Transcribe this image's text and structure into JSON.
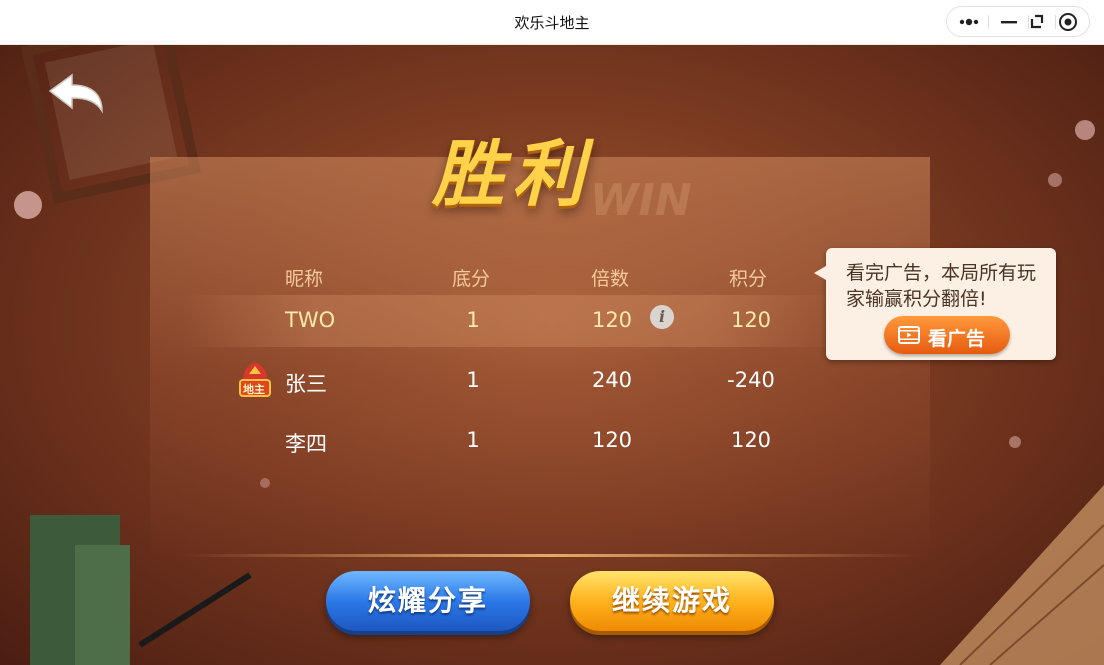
{
  "window": {
    "title": "欢乐斗地主"
  },
  "result": {
    "title": "胜利",
    "watermark": "WIN"
  },
  "table": {
    "headers": [
      "昵称",
      "底分",
      "倍数",
      "积分"
    ],
    "rows": [
      {
        "name": "TWO",
        "base": "1",
        "multiplier": "120",
        "score": "120",
        "is_landlord": false,
        "highlighted": true
      },
      {
        "name": "张三",
        "base": "1",
        "multiplier": "240",
        "score": "-240",
        "is_landlord": true,
        "highlighted": false
      },
      {
        "name": "李四",
        "base": "1",
        "multiplier": "120",
        "score": "120",
        "is_landlord": false,
        "highlighted": false
      }
    ],
    "landlord_badge": "地主",
    "info_icon": "i"
  },
  "ad_tip": {
    "text": "看完广告，本局所有玩家输赢积分翻倍!",
    "button_label": "看广告"
  },
  "buttons": {
    "share": "炫耀分享",
    "continue": "继续游戏"
  },
  "colors": {
    "title_gold": "#ffd24a",
    "share_blue": "#2c79e8",
    "continue_orange": "#ffb31f",
    "bg_brown": "#7c3b21"
  }
}
